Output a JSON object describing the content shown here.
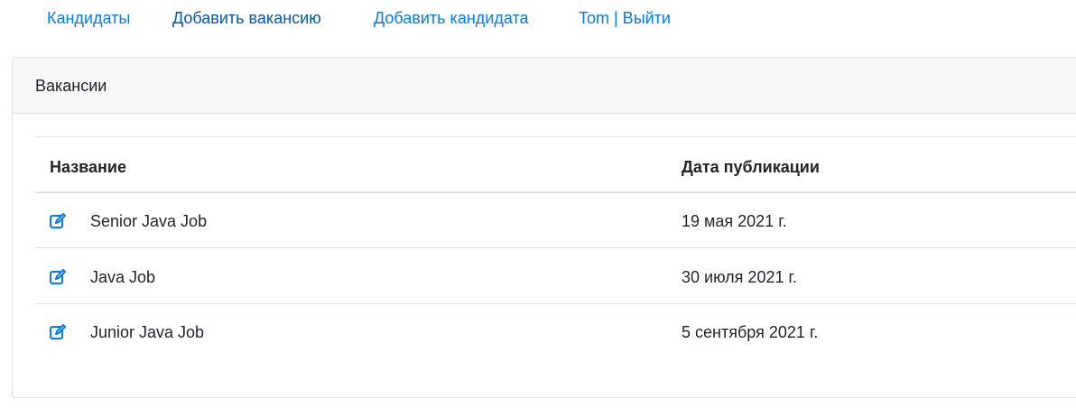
{
  "nav": {
    "items": [
      {
        "label": "Кандидаты"
      },
      {
        "label": "Добавить вакансию"
      },
      {
        "label": "Добавить кандидата"
      },
      {
        "label": "Tom | Выйти"
      }
    ]
  },
  "card": {
    "title": "Вакансии"
  },
  "table": {
    "headers": [
      "Название",
      "Дата публикации"
    ],
    "rows": [
      {
        "name": "Senior Java Job",
        "date": "19 мая 2021 г."
      },
      {
        "name": "Java Job",
        "date": "30 июля 2021 г."
      },
      {
        "name": "Junior Java Job",
        "date": "5 сентября 2021 г."
      }
    ]
  },
  "colors": {
    "link": "#007bff",
    "link_active": "#0056b3",
    "header_bg": "#f7f7f7",
    "border": "#dee2e6"
  },
  "icons": {
    "row_action": "edit-icon"
  }
}
